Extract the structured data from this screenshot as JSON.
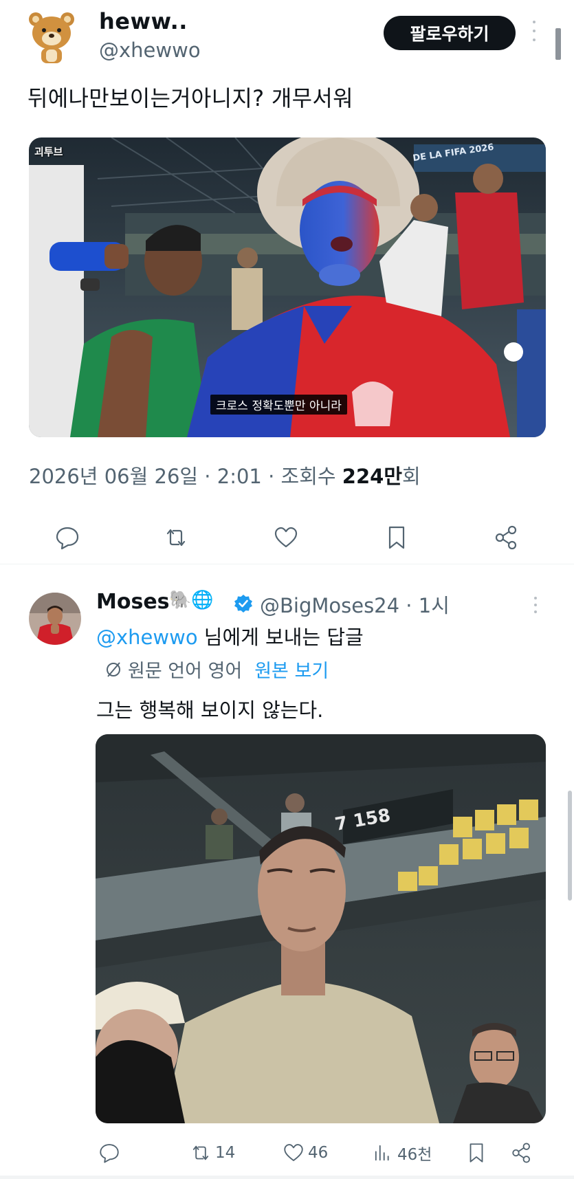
{
  "main_tweet": {
    "display_name": "heww..",
    "handle": "@xhewwo",
    "follow_label": "팔로우하기",
    "text": "뒤에나만보이는거아니지?  개무서워",
    "photo_subtitle": "크로스 정확도뿐만 아니라",
    "photo_watermark": "괴투브",
    "photo_banner": "DE LA FIFA 2026",
    "meta_date": "2026년 06월 26일 · 2:01 · 조회수 ",
    "meta_views": "224만",
    "meta_views_suffix": "회",
    "actions": [
      "reply-icon",
      "retweet-icon",
      "like-icon",
      "bookmark-icon",
      "share-icon"
    ]
  },
  "reply": {
    "display_name": "Moses",
    "name_emojis": "🐘🌐",
    "handle_time": "@BigMoses24 · 1시",
    "reply_to_mention": "@xhewwo",
    "reply_to_suffix": " 님에게 보내는 답글",
    "translate_label": "원문 언어 영어",
    "translate_link": "원본 보기",
    "text": "그는 행복해 보이지 않는다.",
    "photo_sign": "7  158",
    "stats": {
      "retweets": "14",
      "likes": "46",
      "views": "46천"
    }
  },
  "colors": {
    "accent": "#1d9bf0",
    "muted": "#536471",
    "text": "#0f1419"
  }
}
